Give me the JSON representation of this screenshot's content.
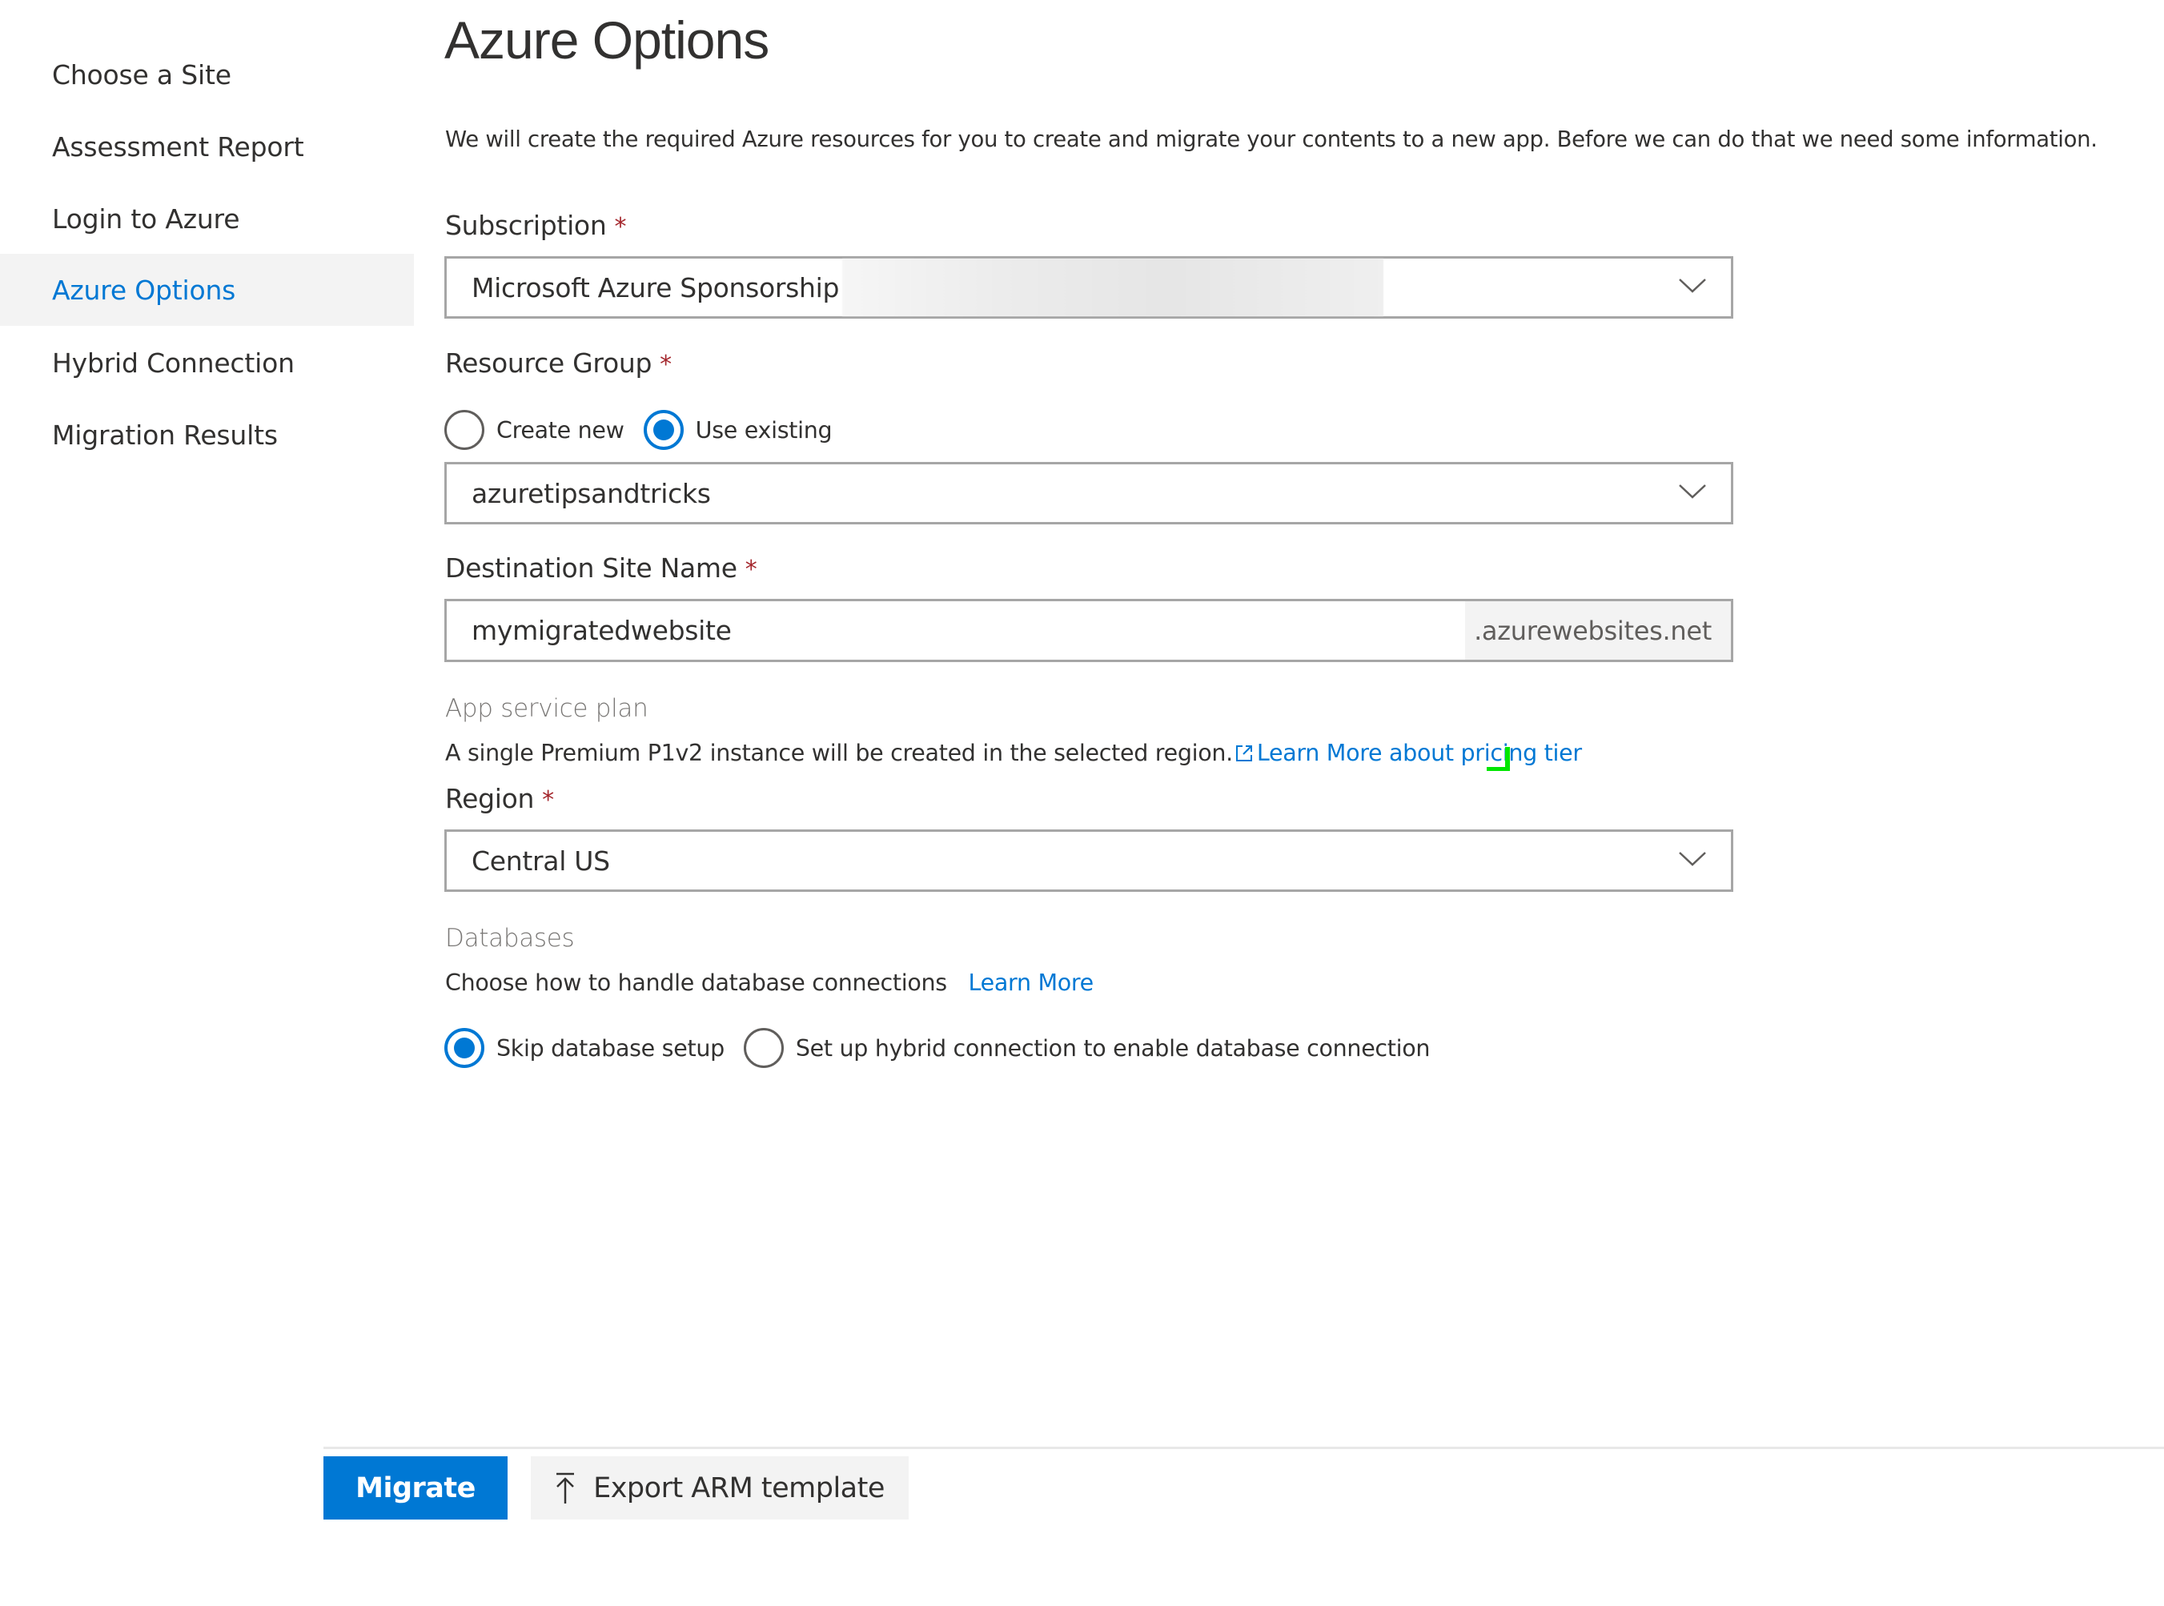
{
  "sidebar": {
    "items": [
      {
        "label": "Choose a Site",
        "active": false
      },
      {
        "label": "Assessment Report",
        "active": false
      },
      {
        "label": "Login to Azure",
        "active": false
      },
      {
        "label": "Azure Options",
        "active": true
      },
      {
        "label": "Hybrid Connection",
        "active": false
      },
      {
        "label": "Migration Results",
        "active": false
      }
    ]
  },
  "main": {
    "title": "Azure Options",
    "description": "We will create the required Azure resources for you to create and migrate your contents to a new app. Before we can do that we need some information.",
    "subscription": {
      "label": "Subscription",
      "required_mark": "*",
      "value": "Microsoft Azure Sponsorship",
      "value_redacted": true
    },
    "resource_group": {
      "label": "Resource Group",
      "required_mark": "*",
      "options": [
        {
          "label": "Create new",
          "checked": false
        },
        {
          "label": "Use existing",
          "checked": true
        }
      ],
      "value": "azuretipsandtricks"
    },
    "destination_site": {
      "label": "Destination Site Name",
      "required_mark": "*",
      "value": "mymigratedwebsite",
      "suffix": ".azurewebsites.net"
    },
    "app_service_plan": {
      "section_label": "App service plan",
      "text": "A single Premium P1v2 instance will be created in the selected region.",
      "link_label": "Learn More about pricing tier",
      "link_icon": "external-link-icon"
    },
    "region": {
      "label": "Region",
      "required_mark": "*",
      "value": "Central US"
    },
    "databases": {
      "section_label": "Databases",
      "text": "Choose how to handle database connections",
      "link_label": "Learn More",
      "options": [
        {
          "label": "Skip database setup",
          "checked": true
        },
        {
          "label": "Set up hybrid connection to enable database connection",
          "checked": false
        }
      ]
    }
  },
  "footer": {
    "migrate_label": "Migrate",
    "export_label": "Export ARM template",
    "export_icon": "upload-icon"
  },
  "colors": {
    "accent": "#0078d4",
    "required": "#a4262c",
    "active_nav_bg": "#f3f3f3",
    "cursor_marker": "#00ff00"
  }
}
